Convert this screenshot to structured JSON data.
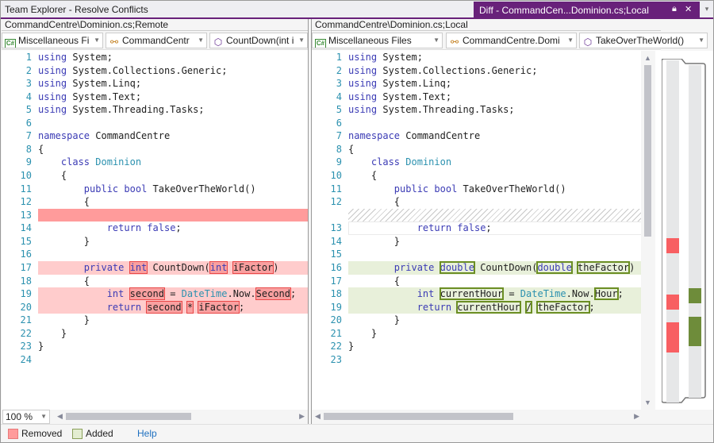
{
  "window": {
    "title": "Team Explorer - Resolve Conflicts",
    "doc_tab_label": "Diff - CommandCen...Dominion.cs;Local",
    "tab_icons": [
      "pin-icon",
      "float-icon",
      "close-icon"
    ],
    "tab_close_glyph": "✕",
    "tab_dropdown_glyph": "▾"
  },
  "colors": {
    "accent": "#68217a",
    "removed": "#ff9b9b",
    "removed_line": "#ffcccc",
    "added": "#e8f0da",
    "added_border": "#6b8e23",
    "overview_removed": "#f85f62",
    "overview_added": "#6e8c3a"
  },
  "left": {
    "path": "CommandCentre\\Dominion.cs;Remote",
    "project_combo": "Miscellaneous Fi",
    "class_combo": "CommandCentr",
    "member_combo": "CountDown(int i"
  },
  "right": {
    "path": "CommandCentre\\Dominion.cs;Local",
    "project_combo": "Miscellaneous Files",
    "class_combo": "CommandCentre.Domi",
    "member_combo": "TakeOverTheWorld()"
  },
  "left_lines": [
    {
      "n": "1",
      "html": "<span class='kw2'>using</span> System;"
    },
    {
      "n": "2",
      "html": "<span class='kw2'>using</span> System.Collections.Generic;"
    },
    {
      "n": "3",
      "html": "<span class='kw2'>using</span> System.Linq;"
    },
    {
      "n": "4",
      "html": "<span class='kw2'>using</span> System.Text;"
    },
    {
      "n": "5",
      "html": "<span class='kw2'>using</span> System.Threading.Tasks;"
    },
    {
      "n": "6",
      "html": ""
    },
    {
      "n": "7",
      "html": "<span class='kw2'>namespace</span> CommandCentre"
    },
    {
      "n": "8",
      "html": "{"
    },
    {
      "n": "9",
      "html": "    <span class='kw2'>class</span> <span class='typ'>Dominion</span>"
    },
    {
      "n": "10",
      "html": "    {"
    },
    {
      "n": "11",
      "html": "        <span class='kw2'>public</span> <span class='kw2'>bool</span> TakeOverTheWorld()"
    },
    {
      "n": "12",
      "html": "        {"
    },
    {
      "n": "13",
      "html": "",
      "cls": "removed-strong"
    },
    {
      "n": "14",
      "html": "            <span class='kw2'>return</span> <span class='kw2'>false</span>;"
    },
    {
      "n": "15",
      "html": "        }"
    },
    {
      "n": "16",
      "html": ""
    },
    {
      "n": "17",
      "html": "        <span class='kw2'>private</span> <span class='rem-word kw2'>int</span> CountDown(<span class='rem-word kw2'>int</span> <span class='rem-word'>iFactor</span>)",
      "cls": "removed-line"
    },
    {
      "n": "18",
      "html": "        {"
    },
    {
      "n": "19",
      "html": "            <span class='kw2'>int</span> <span class='rem-word'>second</span> = <span class='typ'>DateTime</span>.Now.<span class='rem-word'>Second</span>;",
      "cls": "removed-line"
    },
    {
      "n": "20",
      "html": "            <span class='kw2'>return</span> <span class='rem-word'>second</span> <span class='rem-word'>*</span> <span class='rem-word'>iFactor</span>;",
      "cls": "removed-line"
    },
    {
      "n": "21",
      "html": "        }"
    },
    {
      "n": "22",
      "html": "    }"
    },
    {
      "n": "23",
      "html": "}"
    },
    {
      "n": "24",
      "html": ""
    }
  ],
  "right_lines": [
    {
      "n": "1",
      "html": "<span class='kw2'>using</span> System;"
    },
    {
      "n": "2",
      "html": "<span class='kw2'>using</span> System.Collections.Generic;"
    },
    {
      "n": "3",
      "html": "<span class='kw2'>using</span> System.Linq;"
    },
    {
      "n": "4",
      "html": "<span class='kw2'>using</span> System.Text;"
    },
    {
      "n": "5",
      "html": "<span class='kw2'>using</span> System.Threading.Tasks;"
    },
    {
      "n": "6",
      "html": ""
    },
    {
      "n": "7",
      "html": "<span class='kw2'>namespace</span> CommandCentre"
    },
    {
      "n": "8",
      "html": "{"
    },
    {
      "n": "9",
      "html": "    <span class='kw2'>class</span> <span class='typ'>Dominion</span>"
    },
    {
      "n": "10",
      "html": "    {"
    },
    {
      "n": "11",
      "html": "        <span class='kw2'>public</span> <span class='kw2'>bool</span> TakeOverTheWorld()"
    },
    {
      "n": "12",
      "html": "        {"
    },
    {
      "n": "",
      "html": "",
      "cls": "hatch"
    },
    {
      "n": "13",
      "html": "            <span class='kw2'>return</span> <span class='kw2'>false</span>;",
      "cls": "linebox"
    },
    {
      "n": "14",
      "html": "        }"
    },
    {
      "n": "15",
      "html": ""
    },
    {
      "n": "16",
      "html": "        <span class='kw2'>private</span> <span class='add-word kw2'>double</span> CountDown(<span class='add-word kw2'>double</span> <span class='add-word'>theFactor</span>)",
      "cls": "added-line"
    },
    {
      "n": "17",
      "html": "        {"
    },
    {
      "n": "18",
      "html": "            <span class='kw2'>int</span> <span class='add-word'>currentHour</span> = <span class='typ'>DateTime</span>.Now.<span class='add-word'>Hour</span>;",
      "cls": "added-line"
    },
    {
      "n": "19",
      "html": "            <span class='kw2'>return</span> <span class='add-word'>currentHour</span> <span class='add-word'>/</span> <span class='add-word'>theFactor</span>;",
      "cls": "added-line"
    },
    {
      "n": "20",
      "html": "        }"
    },
    {
      "n": "21",
      "html": "    }"
    },
    {
      "n": "22",
      "html": "}"
    },
    {
      "n": "23",
      "html": ""
    }
  ],
  "overview": {
    "removed_marks": [
      {
        "start_frac": 0.523,
        "end_frac": 0.564
      },
      {
        "start_frac": 0.68,
        "end_frac": 0.722
      },
      {
        "start_frac": 0.757,
        "end_frac": 0.841
      }
    ],
    "added_marks": [
      {
        "start_frac": 0.662,
        "end_frac": 0.703
      },
      {
        "start_frac": 0.741,
        "end_frac": 0.822
      }
    ]
  },
  "scroll": {
    "left_h_thumb_frac": [
      0.0,
      0.55
    ],
    "right_h_thumb_frac": [
      0.0,
      0.62
    ],
    "v_thumb_frac": [
      0.0,
      0.52
    ]
  },
  "zoom": {
    "value": "100 %"
  },
  "legend": {
    "removed_label": "Removed",
    "added_label": "Added",
    "help_label": "Help"
  }
}
